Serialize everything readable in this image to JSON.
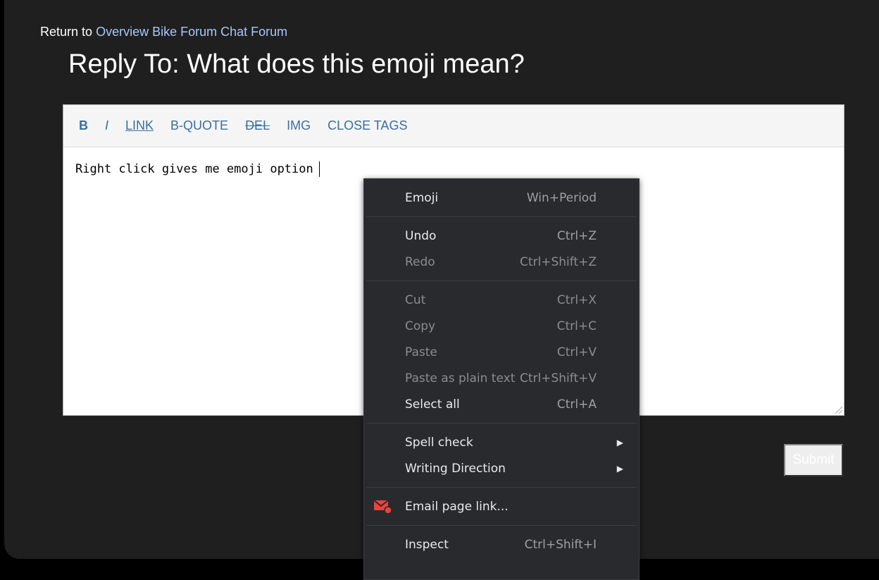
{
  "breadcrumb": {
    "prefix": "Return to",
    "link": "Overview Bike Forum Chat Forum"
  },
  "title": "Reply To: What does this emoji mean?",
  "toolbar": {
    "bold": "B",
    "italic": "I",
    "link": "LINK",
    "bquote": "B-QUOTE",
    "del": "DEL",
    "img": "IMG",
    "close": "CLOSE TAGS"
  },
  "editor_text": "Right click gives me emoji option",
  "submit": "Submit",
  "menu": {
    "emoji": {
      "label": "Emoji",
      "shortcut": "Win+Period"
    },
    "undo": {
      "label": "Undo",
      "shortcut": "Ctrl+Z"
    },
    "redo": {
      "label": "Redo",
      "shortcut": "Ctrl+Shift+Z"
    },
    "cut": {
      "label": "Cut",
      "shortcut": "Ctrl+X"
    },
    "copy": {
      "label": "Copy",
      "shortcut": "Ctrl+C"
    },
    "paste": {
      "label": "Paste",
      "shortcut": "Ctrl+V"
    },
    "paste_plain": {
      "label": "Paste as plain text",
      "shortcut": "Ctrl+Shift+V"
    },
    "select_all": {
      "label": "Select all",
      "shortcut": "Ctrl+A"
    },
    "spell": {
      "label": "Spell check"
    },
    "direction": {
      "label": "Writing Direction"
    },
    "email": {
      "label": "Email page link..."
    },
    "inspect": {
      "label": "Inspect",
      "shortcut": "Ctrl+Shift+I"
    }
  },
  "colors": {
    "link": "#a8c7fa",
    "toolbar": "#3b6ea0",
    "menu_bg": "#292a2d",
    "email_icon": "#e8453c"
  }
}
